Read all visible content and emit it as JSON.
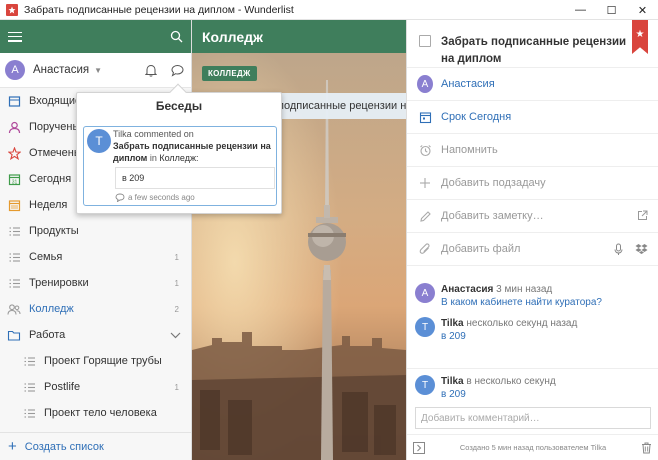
{
  "window": {
    "title": "Забрать подписанные рецензии на диплом - Wunderlist",
    "minimize": "—",
    "maximize": "☐",
    "close": "✕"
  },
  "sidebar": {
    "user": {
      "initial": "А",
      "name": "Анастасия"
    },
    "items": [
      {
        "label": "Входящие",
        "icon": "inbox-icon",
        "count": ""
      },
      {
        "label": "Поручены",
        "icon": "person-icon",
        "count": ""
      },
      {
        "label": "Отмечены",
        "icon": "star-icon",
        "count": ""
      },
      {
        "label": "Сегодня",
        "icon": "calendar-icon",
        "count": ""
      },
      {
        "label": "Неделя",
        "icon": "week-icon",
        "count": ""
      },
      {
        "label": "Продукты",
        "icon": "list-icon",
        "count": ""
      },
      {
        "label": "Семья",
        "icon": "list-icon",
        "count": "1"
      },
      {
        "label": "Тренировки",
        "icon": "list-icon",
        "count": "1"
      },
      {
        "label": "Колледж",
        "icon": "shared-list-icon",
        "count": "2"
      },
      {
        "label": "Работа",
        "icon": "folder-icon",
        "count": ""
      },
      {
        "label": "Проект Горящие трубы",
        "icon": "list-icon",
        "count": ""
      },
      {
        "label": "Postlife",
        "icon": "list-icon",
        "count": "1"
      },
      {
        "label": "Проект тело человека",
        "icon": "list-icon",
        "count": ""
      }
    ],
    "create_list": "Создать список"
  },
  "center": {
    "list_title": "Колледж",
    "tag": "КОЛЛЕДЖ",
    "task_visible_text": "подписанные рецензии на ди"
  },
  "popover": {
    "title": "Беседы",
    "avatar_initial": "T",
    "author": "Tilka",
    "action": "commented on",
    "task": "Забрать подписанные рецензии на диплом",
    "in_word": "in",
    "list": "Колледж:",
    "quote": "в 209",
    "time": "a few seconds ago"
  },
  "detail": {
    "task_title": "Забрать подписанные рецензии на диплом",
    "assignee": "Анастасия",
    "assignee_initial": "А",
    "due": "Срок Сегодня",
    "remind": "Напомнить",
    "add_subtask": "Добавить подзадачу",
    "add_note": "Добавить заметку…",
    "add_file": "Добавить файл",
    "comments": [
      {
        "initial": "А",
        "name": "Анастасия",
        "time": "3 мин назад",
        "text": "В каком кабинете найти куратора?",
        "color": "#8a7fd0"
      },
      {
        "initial": "T",
        "name": "Tilka",
        "time": "несколько секунд назад",
        "text": "в 209",
        "color": "#5b8fd6"
      },
      {
        "initial": "T",
        "name": "Tilka",
        "time": "в несколько секунд",
        "text": "в 209",
        "color": "#5b8fd6"
      }
    ],
    "comment_placeholder": "Добавить комментарий…",
    "created_text": "Создано 5 мин назад пользователем Tilka"
  },
  "colors": {
    "brand_green": "#3f7e5c",
    "link_blue": "#2f6fb7",
    "ribbon_red": "#d9453d"
  }
}
